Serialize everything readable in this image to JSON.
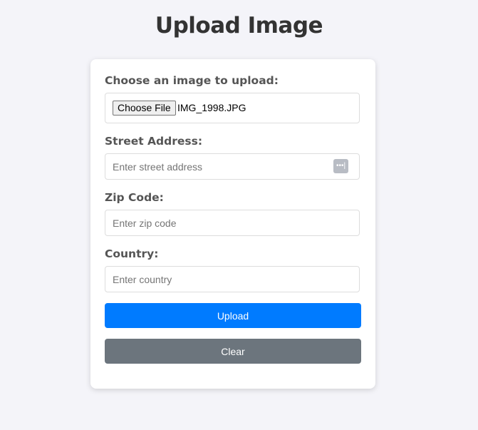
{
  "title": "Upload Image",
  "file": {
    "label": "Choose an image to upload:",
    "button": "Choose File",
    "filename": "IMG_1998.JPG"
  },
  "street": {
    "label": "Street Address:",
    "placeholder": "Enter street address",
    "icon": "password-manager-icon"
  },
  "zip": {
    "label": "Zip Code:",
    "placeholder": "Enter zip code"
  },
  "country": {
    "label": "Country:",
    "placeholder": "Enter country"
  },
  "upload": {
    "label": "Upload",
    "color": "#007bff"
  },
  "clear": {
    "label": "Clear",
    "color": "#6c757d"
  }
}
